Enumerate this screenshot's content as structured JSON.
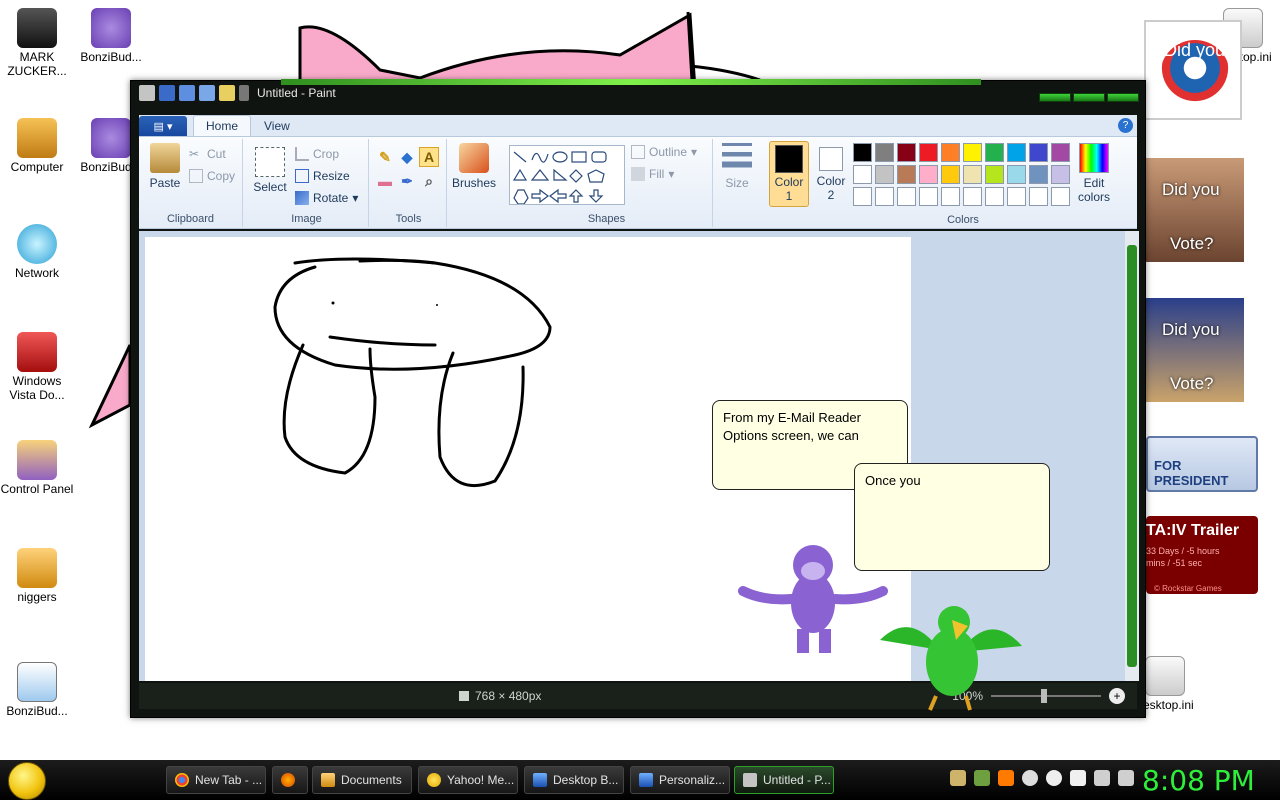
{
  "desktop": {
    "icons": [
      {
        "label": "MARK ZUCKER..."
      },
      {
        "label": "BonziBud..."
      },
      {
        "label": "Computer"
      },
      {
        "label": "BonziBud..."
      },
      {
        "label": "Network"
      },
      {
        "label": "Windows Vista Do..."
      },
      {
        "label": "Control Panel"
      },
      {
        "label": "niggers"
      },
      {
        "label": "BonziBud..."
      },
      {
        "label": "desktop.ini"
      },
      {
        "label": "desktop.ini"
      }
    ]
  },
  "gadgets": {
    "obama_text": "Did you",
    "mccain_top": "Did you",
    "mccain_bottom": "Vote?",
    "clinton_top": "Did you",
    "clinton_bottom": "Vote?",
    "president_text": "FOR PRESIDENT",
    "trailer_title": "TA:IV Trailer",
    "trailer_line1": "33 Days / -5 hours",
    "trailer_line2": "mins / -51 sec",
    "trailer_footer": "© Rockstar Games"
  },
  "paint": {
    "title": "Untitled - Paint",
    "tabs": {
      "home": "Home",
      "view": "View"
    },
    "clipboard": {
      "paste": "Paste",
      "cut": "Cut",
      "copy": "Copy",
      "group": "Clipboard"
    },
    "image": {
      "select": "Select",
      "crop": "Crop",
      "resize": "Resize",
      "rotate": "Rotate",
      "group": "Image"
    },
    "tools": {
      "text_tool": "A",
      "group": "Tools"
    },
    "brushes": "Brushes",
    "shapes": {
      "outline": "Outline",
      "fill": "Fill",
      "group": "Shapes"
    },
    "size": "Size",
    "color1": {
      "line1": "Color",
      "line2": "1"
    },
    "color2": {
      "line1": "Color",
      "line2": "2"
    },
    "edit_colors": {
      "line1": "Edit",
      "line2": "colors"
    },
    "colors_group": "Colors",
    "palette": [
      "#000000",
      "#7f7f7f",
      "#880015",
      "#ed1c24",
      "#ff7f27",
      "#fff200",
      "#22b14c",
      "#00a2e8",
      "#3f48cc",
      "#a349a4",
      "#ffffff",
      "#c3c3c3",
      "#b97a57",
      "#ffaec9",
      "#ffc90e",
      "#efe4b0",
      "#b5e61d",
      "#99d9ea",
      "#7092be",
      "#c8bfe7"
    ],
    "status": {
      "dimensions": "768 × 480px",
      "zoom": "100%"
    }
  },
  "balloons": {
    "bonzi": "From my E-Mail Reader Options screen, we can",
    "parrot": "Once you"
  },
  "taskbar": {
    "items": [
      {
        "label": "New Tab - ..."
      },
      {
        "label": ""
      },
      {
        "label": "Documents"
      },
      {
        "label": "Yahoo! Me..."
      },
      {
        "label": "Desktop B..."
      },
      {
        "label": "Personaliz..."
      },
      {
        "label": "Untitled - P..."
      }
    ],
    "clock": "8:08 PM"
  },
  "colors": {
    "accent": "#2ef03a",
    "window_frame": "#101410"
  }
}
